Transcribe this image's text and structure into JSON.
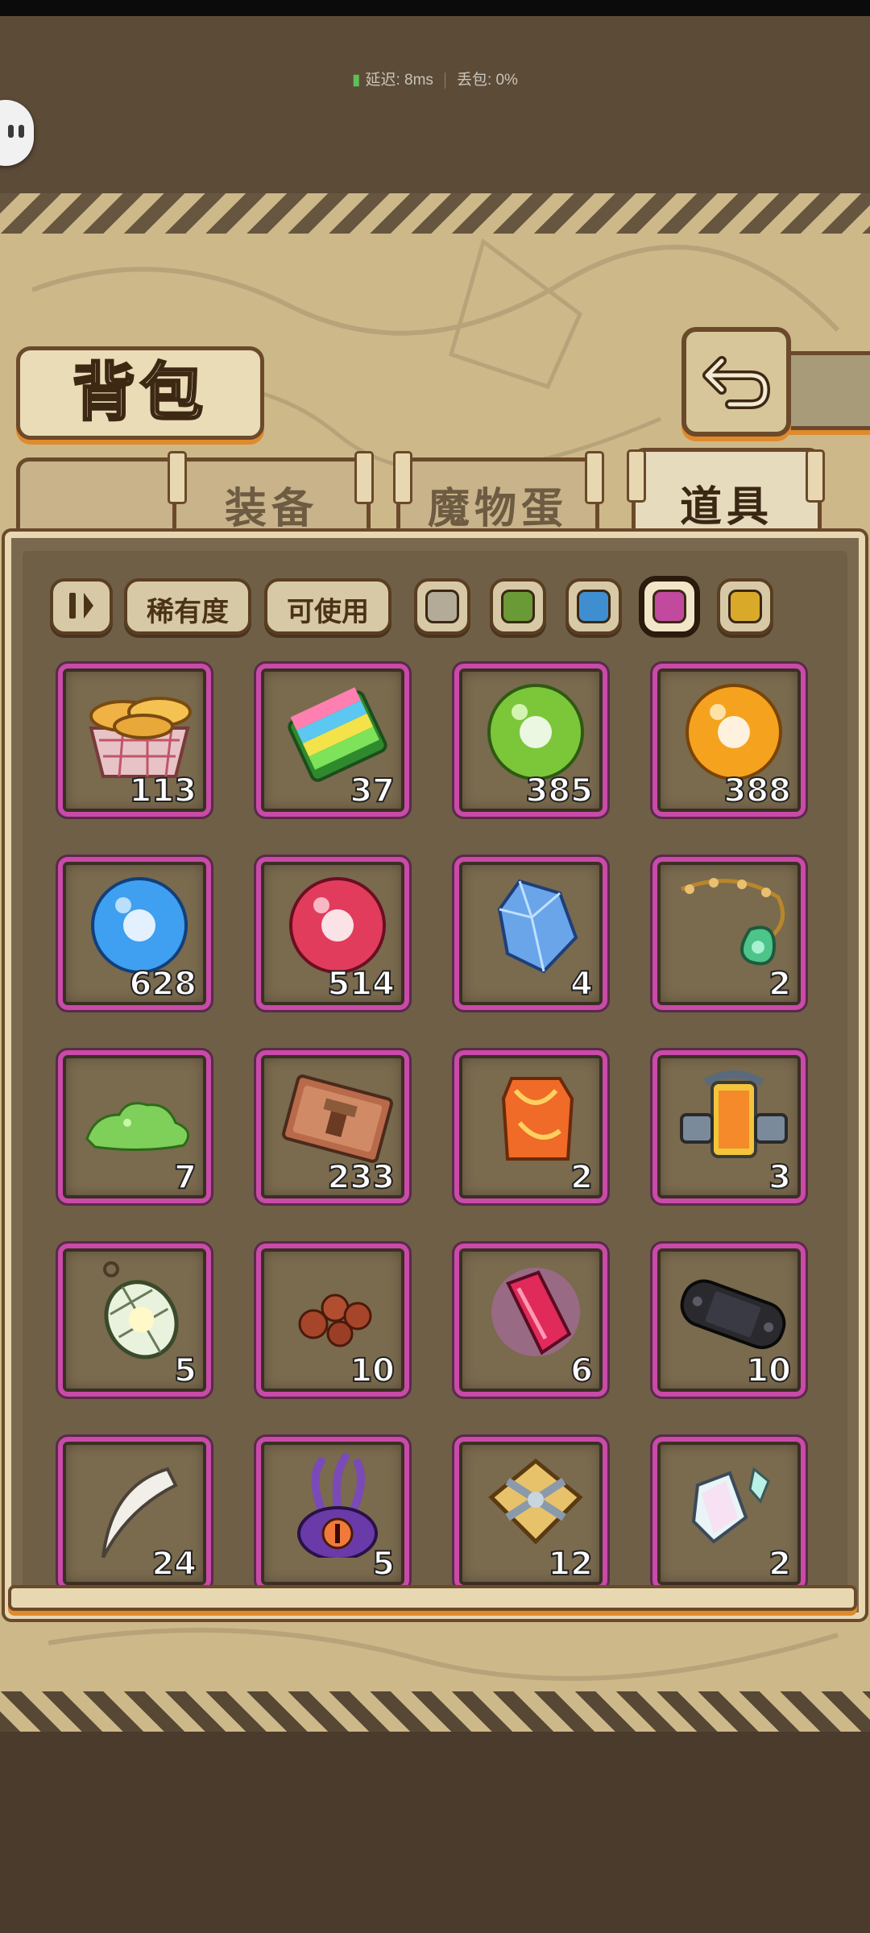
{
  "status": {
    "latency": "延迟: 8ms",
    "loss": "丢包: 0%"
  },
  "title": "背包",
  "tabs": [
    {
      "label": "装备",
      "active": false
    },
    {
      "label": "魔物蛋",
      "active": false
    },
    {
      "label": "道具",
      "active": true
    }
  ],
  "filters": {
    "rarity": "稀有度",
    "usable": "可使用"
  },
  "rarity_swatches": [
    {
      "name": "grey",
      "color": "#b3aa98"
    },
    {
      "name": "green",
      "color": "#6a9a35"
    },
    {
      "name": "blue",
      "color": "#3f8fd0"
    },
    {
      "name": "purple",
      "color": "#c24a9e",
      "selected": true
    },
    {
      "name": "yellow",
      "color": "#d9aa2a"
    }
  ],
  "items": [
    {
      "icon": "bread-basket-icon",
      "count": "113"
    },
    {
      "icon": "sticky-notes-icon",
      "count": "37"
    },
    {
      "icon": "green-orb-icon",
      "count": "385"
    },
    {
      "icon": "orange-orb-icon",
      "count": "388"
    },
    {
      "icon": "blue-orb-icon",
      "count": "628"
    },
    {
      "icon": "red-orb-icon",
      "count": "514"
    },
    {
      "icon": "blue-crystal-icon",
      "count": "4"
    },
    {
      "icon": "flower-necklace-icon",
      "count": "2"
    },
    {
      "icon": "green-slime-icon",
      "count": "7"
    },
    {
      "icon": "hammer-ticket-icon",
      "count": "233"
    },
    {
      "icon": "amber-stone-icon",
      "count": "2"
    },
    {
      "icon": "energy-canister-icon",
      "count": "3"
    },
    {
      "icon": "lantern-icon",
      "count": "5"
    },
    {
      "icon": "berries-icon",
      "count": "10"
    },
    {
      "icon": "magic-crystal-icon",
      "count": "6"
    },
    {
      "icon": "handheld-console-icon",
      "count": "10"
    },
    {
      "icon": "claw-fang-icon",
      "count": "24"
    },
    {
      "icon": "tentacle-eye-icon",
      "count": "5"
    },
    {
      "icon": "golden-emblem-icon",
      "count": "12"
    },
    {
      "icon": "prism-shard-icon",
      "count": "2"
    }
  ]
}
